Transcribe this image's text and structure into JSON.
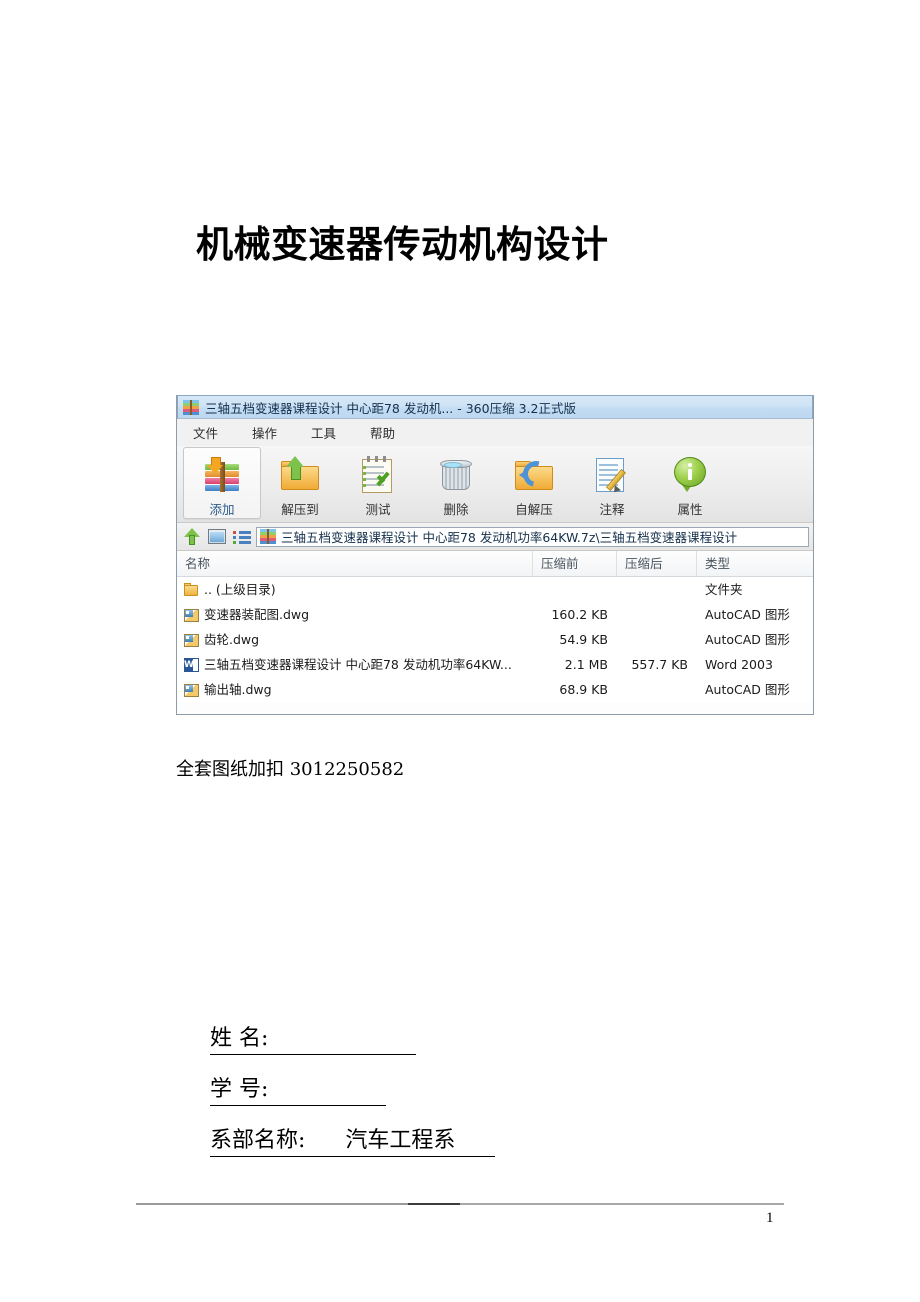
{
  "document": {
    "title": "机械变速器传动机构设计",
    "note": "全套图纸加扣 3012250582",
    "footer_page_number": "1"
  },
  "form": {
    "rows": [
      {
        "label": "姓    名:",
        "value": ""
      },
      {
        "label": "学    号:",
        "value": ""
      },
      {
        "label": "系部名称:",
        "value": "汽车工程系"
      }
    ]
  },
  "zip_window": {
    "titlebar": {
      "icon": "archive-icon",
      "text": "三轴五档变速器课程设计 中心距78 发动机... - 360压缩 3.2正式版"
    },
    "menu": [
      {
        "label": "文件"
      },
      {
        "label": "操作"
      },
      {
        "label": "工具"
      },
      {
        "label": "帮助"
      }
    ],
    "toolbar": [
      {
        "label": "添加",
        "icon": "add-to-archive-icon",
        "active": true
      },
      {
        "label": "解压到",
        "icon": "extract-to-icon",
        "active": false
      },
      {
        "label": "测试",
        "icon": "test-archive-icon",
        "active": false
      },
      {
        "label": "删除",
        "icon": "delete-icon",
        "active": false
      },
      {
        "label": "自解压",
        "icon": "self-extract-icon",
        "active": false
      },
      {
        "label": "注释",
        "icon": "comment-icon",
        "active": false
      },
      {
        "label": "属性",
        "icon": "properties-icon",
        "active": false
      }
    ],
    "addressbar": {
      "up_icon": "up-arrow-icon",
      "window_icon": "window-view-icon",
      "list_icon": "list-view-icon",
      "path_icon": "archive-icon",
      "path": "三轴五档变速器课程设计 中心距78 发动机功率64KW.7z\\三轴五档变速器课程设计"
    },
    "columns": [
      {
        "label": "名称"
      },
      {
        "label": "压缩前"
      },
      {
        "label": "压缩后"
      },
      {
        "label": "类型"
      }
    ],
    "rows": [
      {
        "icon": "folder-icon",
        "name": ".. (上级目录)",
        "size_before": "",
        "size_after": "",
        "type": "文件夹"
      },
      {
        "icon": "dwg-icon",
        "name": "变速器装配图.dwg",
        "size_before": "160.2 KB",
        "size_after": "",
        "type": "AutoCAD 图形"
      },
      {
        "icon": "dwg-icon",
        "name": "齿轮.dwg",
        "size_before": "54.9 KB",
        "size_after": "",
        "type": "AutoCAD 图形"
      },
      {
        "icon": "word-doc-icon",
        "name": "三轴五档变速器课程设计 中心距78 发动机功率64KW...",
        "size_before": "2.1 MB",
        "size_after": "557.7 KB",
        "type": "Word 2003"
      },
      {
        "icon": "dwg-icon",
        "name": "输出轴.dwg",
        "size_before": "68.9 KB",
        "size_after": "",
        "type": "AutoCAD 图形"
      }
    ]
  },
  "colors": {
    "titlebar_blue": "#c9e0f3",
    "toolbar_gray": "#ededed",
    "accent_green": "#7dc24a",
    "word_blue": "#2a5699"
  }
}
